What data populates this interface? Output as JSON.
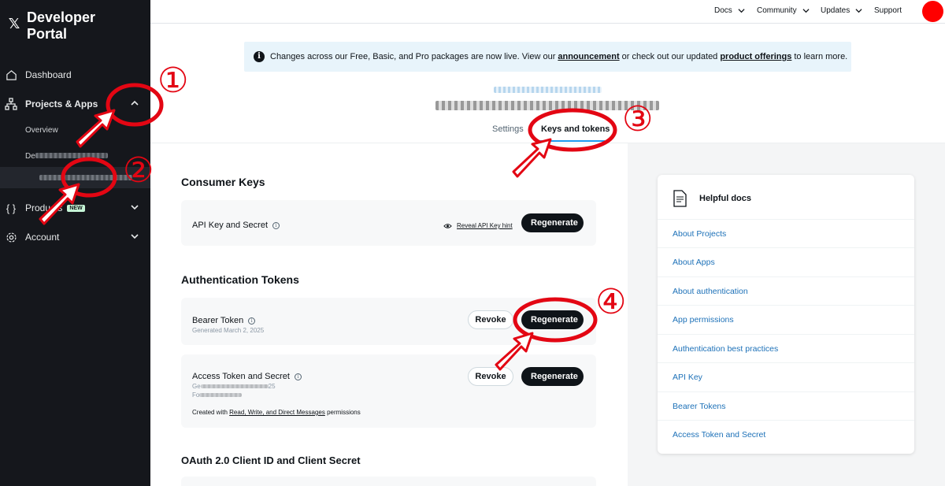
{
  "sidebar": {
    "logo_glyph": "𝕏",
    "title": "Developer Portal",
    "items": [
      {
        "label": "Dashboard",
        "icon": "home-icon"
      },
      {
        "label": "Projects & Apps",
        "icon": "projects-icon"
      },
      {
        "label": "Overview"
      },
      {
        "label": "Products",
        "icon": "braces-icon",
        "badge": "NEW"
      },
      {
        "label": "Account",
        "icon": "gear-icon"
      }
    ],
    "project_prefix": "De"
  },
  "topnav": {
    "links": [
      {
        "label": "Docs"
      },
      {
        "label": "Community"
      },
      {
        "label": "Updates"
      },
      {
        "label": "Support"
      }
    ],
    "avatar_color": "#ff0000"
  },
  "banner": {
    "text_before": "Changes across our Free, Basic, and Pro packages are now live. View our",
    "link1": "announcement",
    "text_middle": "or check out our updated",
    "link2": "product offerings",
    "text_after": "to learn more."
  },
  "tabs": {
    "settings": "Settings",
    "keys": "Keys and tokens"
  },
  "consumer_keys": {
    "title": "Consumer Keys",
    "label": "API Key and Secret",
    "reveal": "Reveal API Key hint",
    "regenerate": "Regenerate"
  },
  "auth_tokens": {
    "title": "Authentication Tokens",
    "bearer": {
      "label": "Bearer Token",
      "generated": "Generated March 2, 2025",
      "revoke": "Revoke",
      "regenerate": "Regenerate"
    },
    "access": {
      "label": "Access Token and Secret",
      "line1": "Ge",
      "line1_end": "25",
      "line2": "Fo",
      "created_prefix": "Created with",
      "created_link": "Read, Write, and Direct Messages",
      "created_suffix": "permissions",
      "revoke": "Revoke",
      "regenerate": "Regenerate"
    }
  },
  "oauth": {
    "title": "OAuth 2.0 Client ID and Client Secret"
  },
  "docs": {
    "title": "Helpful docs",
    "links": [
      "About Projects",
      "About Apps",
      "About authentication",
      "App permissions",
      "Authentication best practices",
      "API Key",
      "Bearer Tokens",
      "Access Token and Secret"
    ]
  },
  "annotations": {
    "color": "#e30613",
    "markers": [
      "①",
      "②",
      "③",
      "④"
    ]
  }
}
